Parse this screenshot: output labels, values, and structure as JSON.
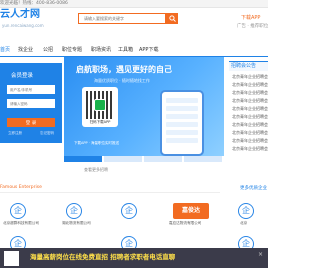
{
  "topbar": {
    "text": "欢迎光临！热线：400-836-0086"
  },
  "header": {
    "logo_text": "云人才网",
    "logo_url": "yun.rencaiwang.com",
    "search_placeholder": "请输入要搜索的关键字",
    "search_icon": "search-icon",
    "app_download": "下载APP",
    "ad_text": "广告 · 推荐职位"
  },
  "nav": {
    "items": [
      "首页",
      "找企业",
      "公招",
      "职位专题",
      "职场资讯",
      "工具箱",
      "APP下载"
    ]
  },
  "login": {
    "title": "会员登录",
    "user_placeholder": "用户名/手机号",
    "pass_placeholder": "请输入密码",
    "button": "登 录",
    "register": "立即注册",
    "forgot": "忘记密码"
  },
  "banner": {
    "title": "启航职场，遇见更好的自己",
    "subtitle": "海量优质职位 · 随时随地找工作",
    "qr_caption": "扫码下载APP",
    "tag": "下载APP · 海量职位实时推送"
  },
  "hot_link": "查看更多招聘",
  "right_column": {
    "title": "招聘会公告",
    "items": [
      "北京青年企业招聘会",
      "北京青年企业招聘会",
      "北京青年企业招聘会",
      "北京青年企业招聘会",
      "北京青年企业招聘会",
      "北京青年企业招聘会",
      "北京青年企业招聘会",
      "北京青年企业招聘会",
      "北京青年企业招聘会",
      "北京青年企业招聘会"
    ]
  },
  "section": {
    "title": "Famous Enterprise",
    "more": "更多优质企业"
  },
  "companies": {
    "row1": [
      "北京超群科技有限公司",
      "湖北物流有限公司",
      "嘉应达物流有限公司",
      "北京"
    ],
    "row2_icon_glyph": "企",
    "gxd_logo": "嘉俊达"
  },
  "float_bar": {
    "text": "海量高薪岗位在线免费直招 招聘者求职者电话直聊",
    "close": "×"
  },
  "colors": {
    "primary": "#1f82e6",
    "accent": "#f26b21",
    "float_bg": "#3b3b4a",
    "float_text": "#ffe04a"
  }
}
